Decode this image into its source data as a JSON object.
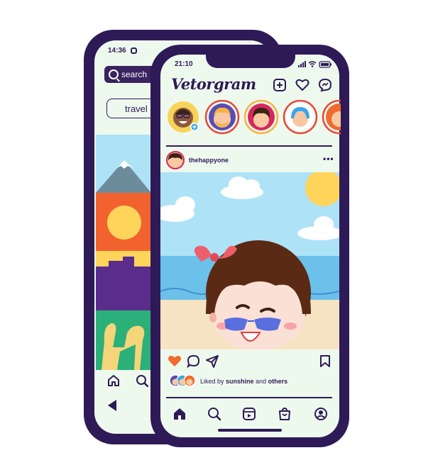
{
  "back_phone": {
    "status_time": "14:36",
    "search": {
      "placeholder": "search"
    },
    "chip_label": "travel"
  },
  "front_phone": {
    "status_time": "21:10",
    "app_logo": "Vetorgram",
    "post": {
      "username": "thehappyone",
      "more": "•••"
    },
    "likes": {
      "prefix": "Liked by",
      "user": "sunshine",
      "joiner": "and",
      "others": "others"
    }
  },
  "colors": {
    "frame": "#2e1a57",
    "screen": "#eef9ee",
    "sky": "#aee2f7",
    "sea": "#6cc1ea",
    "sand": "#f6e3c2",
    "heart": "#f26a2e"
  },
  "icons": [
    "search-icon",
    "camera-icon",
    "home-icon",
    "search-icon",
    "back-arrow-icon",
    "add-post-icon",
    "heart-icon",
    "messenger-icon",
    "comment-icon",
    "share-icon",
    "bookmark-icon",
    "reels-icon",
    "shop-icon",
    "profile-icon"
  ]
}
